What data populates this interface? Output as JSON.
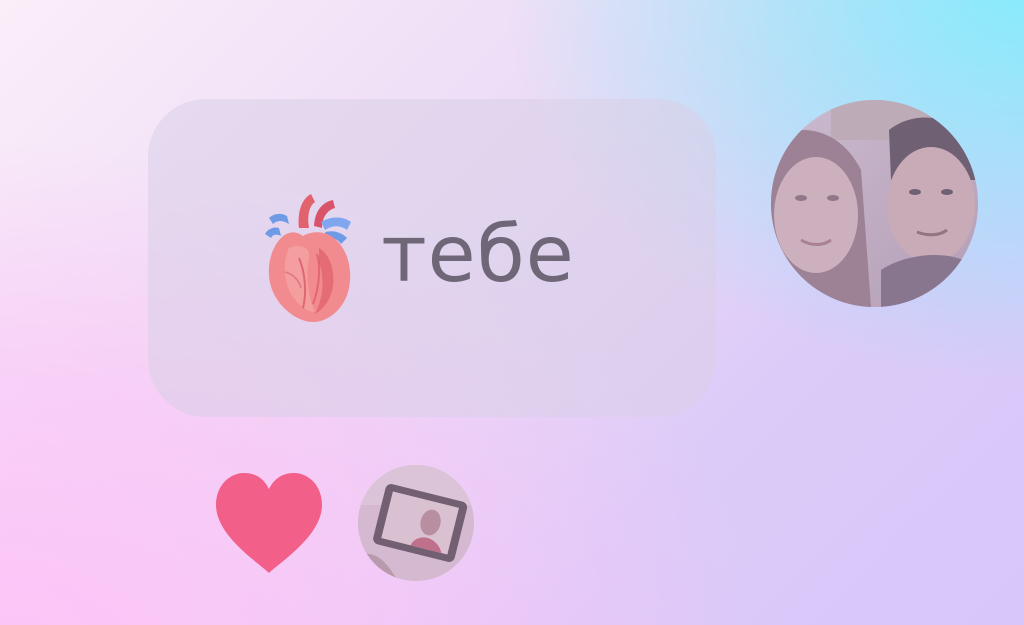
{
  "message": {
    "emoji_icon": "anatomical-heart-icon",
    "text": "тебе"
  },
  "sender": {
    "avatar_icon": "couple-photo-avatar"
  },
  "reaction": {
    "icon": "heart-icon",
    "color": "#f2608a",
    "reactor_avatar_icon": "photo-frame-avatar"
  },
  "colors": {
    "bubble": "#d8d0e8",
    "text": "#6f6777",
    "background_top_right": "#86ecfb",
    "background_bottom_left": "#fdc4f7"
  }
}
